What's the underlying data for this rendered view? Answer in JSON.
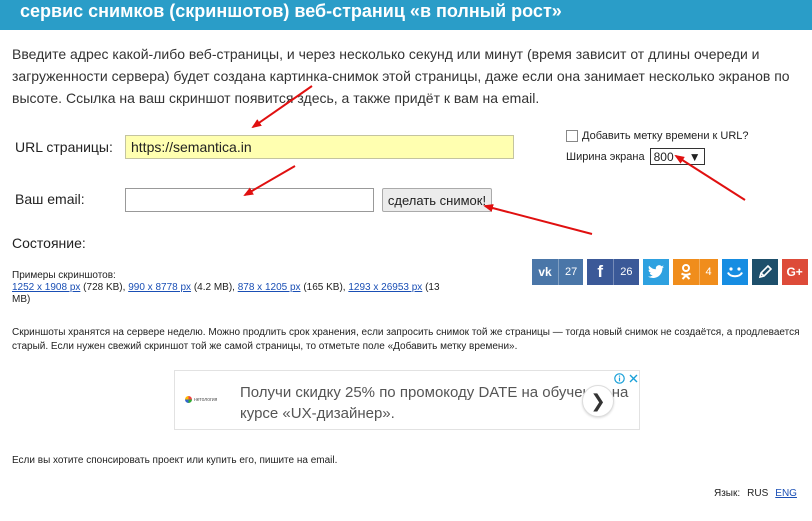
{
  "header": {
    "title": "сервис снимков (скриншотов) веб-страниц «в полный рост»"
  },
  "intro": "Введите адрес какой-либо веб-страницы, и через несколько секунд или минут (время зависит от длины очереди и загруженности сервера) будет создана картинка-снимок этой страницы, даже если она занимает несколько экранов по высоте. Ссылка на ваш скриншот появится здесь, а также придёт к вам на email.",
  "form": {
    "url_label": "URL страницы:",
    "url_value": "https://semantica.in",
    "email_label": "Ваш email:",
    "email_value": "",
    "submit_label": "сделать снимок!",
    "timestamp_label": "Добавить метку времени к URL?",
    "width_label": "Ширина экрана",
    "width_value": "800"
  },
  "status_label": "Состояние:",
  "examples": {
    "title": "Примеры скриншотов:",
    "items": [
      {
        "link": "1252 x 1908 px",
        "size": "(728 KB)"
      },
      {
        "link": "990 x 8778 px",
        "size": "(4.2 MB)"
      },
      {
        "link": "878 x 1205 px",
        "size": "(165 KB)"
      },
      {
        "link": "1293 x 26953 px",
        "size_a": "(13",
        "size_b": "MB)"
      }
    ]
  },
  "social": [
    {
      "name": "vk",
      "icon": "vk",
      "count": "27",
      "color": "#4a76a8"
    },
    {
      "name": "facebook",
      "icon": "f",
      "count": "26",
      "color": "#3b5998"
    },
    {
      "name": "twitter",
      "icon": "twitter-bird",
      "color": "#2ea1e0"
    },
    {
      "name": "odnoklassniki",
      "icon": "ok",
      "count": "4",
      "color": "#f08d1c"
    },
    {
      "name": "moimir",
      "icon": "moimir",
      "color": "#168de2"
    },
    {
      "name": "livejournal",
      "icon": "pencil",
      "color": "#1d4f6b"
    },
    {
      "name": "google-plus",
      "icon": "g+",
      "color": "#dd4b39"
    }
  ],
  "note": "Скриншоты хранятся на сервере неделю. Можно продлить срок хранения, если запросить снимок той же страницы — тогда новый снимок не создаётся, а продлевается старый. Если нужен свежий скриншот той же самой страницы, то отметьте поле «Добавить метку времени».",
  "ad": {
    "text": "Получи скидку 25% по промокоду DATE на обучение на курсе «UX-дизайнер».",
    "logo_text": "нетология"
  },
  "sponsor": "Если вы хотите спонсировать проект или купить его, пишите на email.",
  "lang": {
    "label": "Язык:",
    "current": "RUS",
    "other": "ENG"
  },
  "accent_color": "#2a9dc8"
}
